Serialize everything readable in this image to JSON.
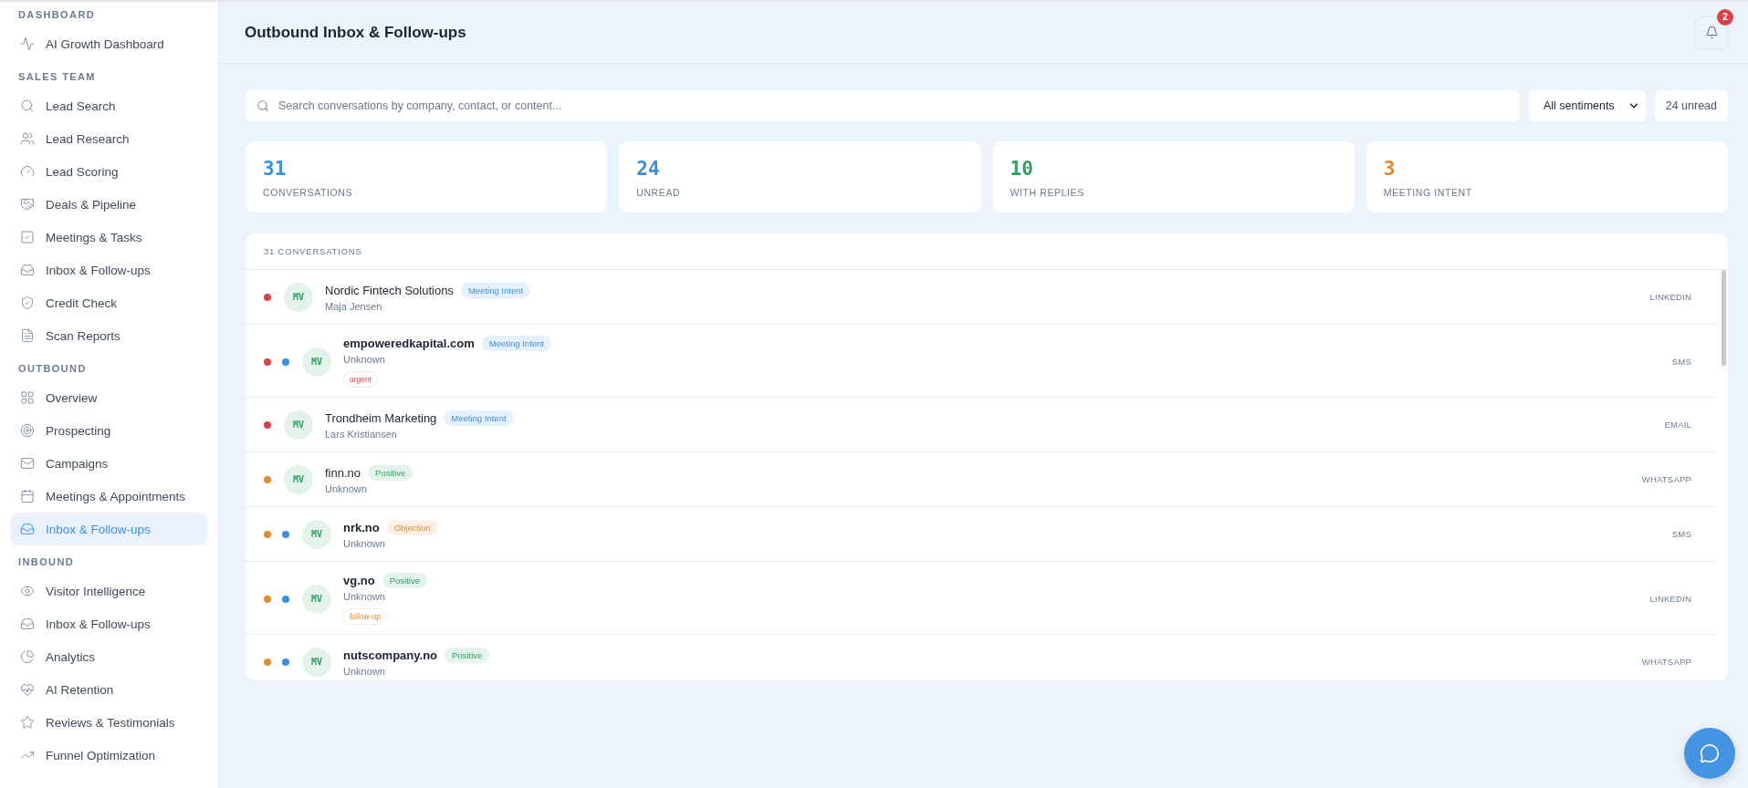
{
  "sidebar": {
    "sections": [
      {
        "title": "DASHBOARD",
        "items": [
          {
            "label": "AI Growth Dashboard",
            "selected": false
          }
        ]
      },
      {
        "title": "SALES TEAM",
        "items": [
          {
            "label": "Lead Search",
            "selected": false
          },
          {
            "label": "Lead Research",
            "selected": false
          },
          {
            "label": "Lead Scoring",
            "selected": false
          },
          {
            "label": "Deals & Pipeline",
            "selected": false
          },
          {
            "label": "Meetings & Tasks",
            "selected": false
          },
          {
            "label": "Inbox & Follow-ups",
            "selected": false
          },
          {
            "label": "Credit Check",
            "selected": false
          },
          {
            "label": "Scan Reports",
            "selected": false
          }
        ]
      },
      {
        "title": "OUTBOUND",
        "items": [
          {
            "label": "Overview",
            "selected": false
          },
          {
            "label": "Prospecting",
            "selected": false
          },
          {
            "label": "Campaigns",
            "selected": false
          },
          {
            "label": "Meetings & Appointments",
            "selected": false
          },
          {
            "label": "Inbox & Follow-ups",
            "selected": true
          }
        ]
      },
      {
        "title": "INBOUND",
        "items": [
          {
            "label": "Visitor Intelligence",
            "selected": false
          },
          {
            "label": "Inbox & Follow-ups",
            "selected": false
          },
          {
            "label": "Analytics",
            "selected": false
          },
          {
            "label": "AI Retention",
            "selected": false
          },
          {
            "label": "Reviews & Testimonials",
            "selected": false
          },
          {
            "label": "Funnel Optimization",
            "selected": false
          }
        ]
      }
    ]
  },
  "header": {
    "title": "Outbound Inbox & Follow-ups",
    "notifications": "2"
  },
  "toolbar": {
    "search": {
      "placeholder": "Search conversations by company, contact, or content..."
    },
    "sentiment_filter": "All sentiments",
    "unread_count": "24 unread"
  },
  "stats": [
    {
      "value": "31",
      "label": "CONVERSATIONS",
      "color": "#3b8fe0"
    },
    {
      "value": "24",
      "label": "UNREAD",
      "color": "#3b8fe0"
    },
    {
      "value": "10",
      "label": "WITH REPLIES",
      "color": "#2e9e63"
    },
    {
      "value": "3",
      "label": "MEETING INTENT",
      "color": "#e08a2a"
    }
  ],
  "conversations": {
    "heading": "31 CONVERSATIONS",
    "rows": [
      {
        "company": "Nordic Fintech Solutions",
        "contact": "Maja Jensen",
        "initials": "MV",
        "sentiment": {
          "kind": "meeting",
          "label": "Meeting Intent"
        },
        "color": "#d9434b",
        "unread": false,
        "channel": "LINKEDIN"
      },
      {
        "company": "empoweredkapital.com",
        "contact": "Unknown",
        "initials": "MV",
        "sentiment": {
          "kind": "meeting",
          "label": "Meeting Intent"
        },
        "color": "#d9434b",
        "unread": true,
        "tag": {
          "kind": "urgent",
          "label": "urgent"
        },
        "channel": "SMS"
      },
      {
        "company": "Trondheim Marketing",
        "contact": "Lars Kristiansen",
        "initials": "MV",
        "sentiment": {
          "kind": "meeting",
          "label": "Meeting Intent"
        },
        "color": "#d9434b",
        "unread": false,
        "channel": "EMAIL"
      },
      {
        "company": "finn.no",
        "contact": "Unknown",
        "initials": "MV",
        "sentiment": {
          "kind": "positive",
          "label": "Positive"
        },
        "color": "#e08a2a",
        "unread": false,
        "channel": "WHATSAPP"
      },
      {
        "company": "nrk.no",
        "contact": "Unknown",
        "initials": "MV",
        "sentiment": {
          "kind": "objection",
          "label": "Objection"
        },
        "color": "#e08a2a",
        "unread": true,
        "channel": "SMS"
      },
      {
        "company": "vg.no",
        "contact": "Unknown",
        "initials": "MV",
        "sentiment": {
          "kind": "positive",
          "label": "Positive"
        },
        "color": "#e08a2a",
        "unread": true,
        "tag": {
          "kind": "followup",
          "label": "follow-up"
        },
        "channel": "LINKEDIN"
      },
      {
        "company": "nutscompany.no",
        "contact": "Unknown",
        "initials": "MV",
        "sentiment": {
          "kind": "positive",
          "label": "Positive"
        },
        "color": "#e08a2a",
        "unread": true,
        "channel": "WHATSAPP"
      }
    ]
  }
}
